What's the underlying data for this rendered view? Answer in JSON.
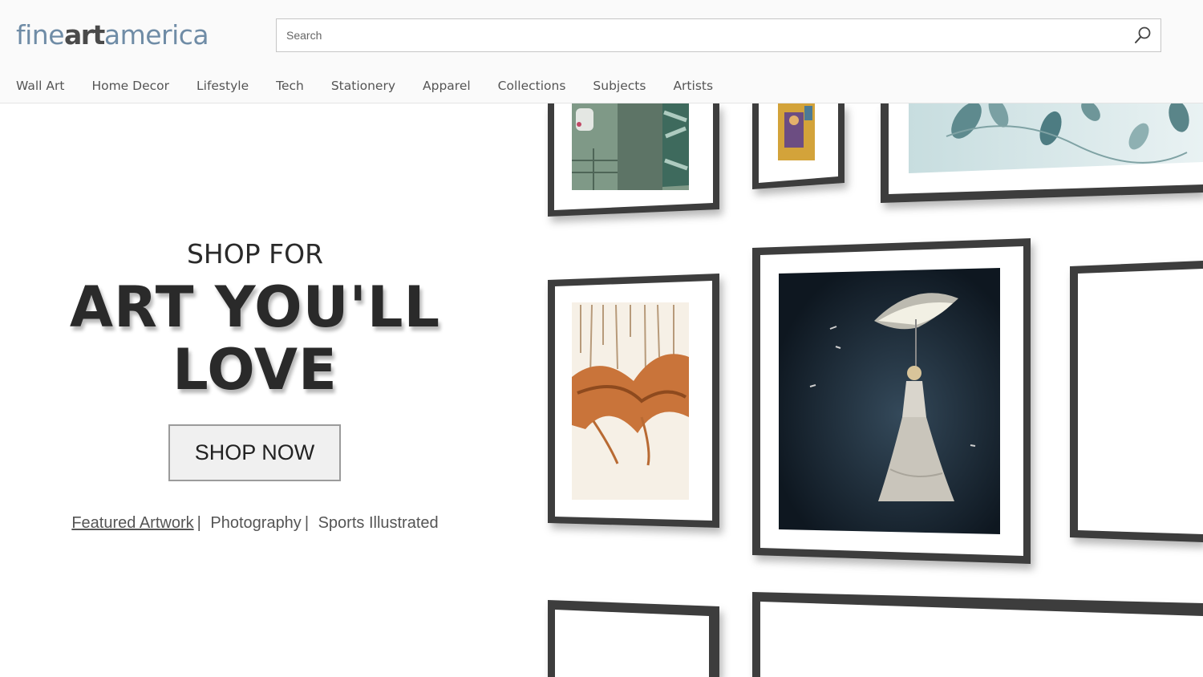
{
  "logo": {
    "part1": "fine",
    "part2": "art",
    "part3": "america"
  },
  "search": {
    "placeholder": "Search",
    "icon": "search-icon"
  },
  "nav": [
    "Wall Art",
    "Home Decor",
    "Lifestyle",
    "Tech",
    "Stationery",
    "Apparel",
    "Collections",
    "Subjects",
    "Artists"
  ],
  "hero": {
    "eyebrow": "SHOP FOR",
    "headline_line1": "ART YOU'LL",
    "headline_line2": "LOVE",
    "cta": "SHOP NOW",
    "links": [
      "Featured Artwork",
      "Photography",
      "Sports Illustrated"
    ],
    "separator": "|"
  },
  "colors": {
    "logo_light": "#6f8ca6",
    "logo_dark": "#4a4a4a",
    "frame": "#3c3c3c",
    "text": "#2a2a2a"
  }
}
